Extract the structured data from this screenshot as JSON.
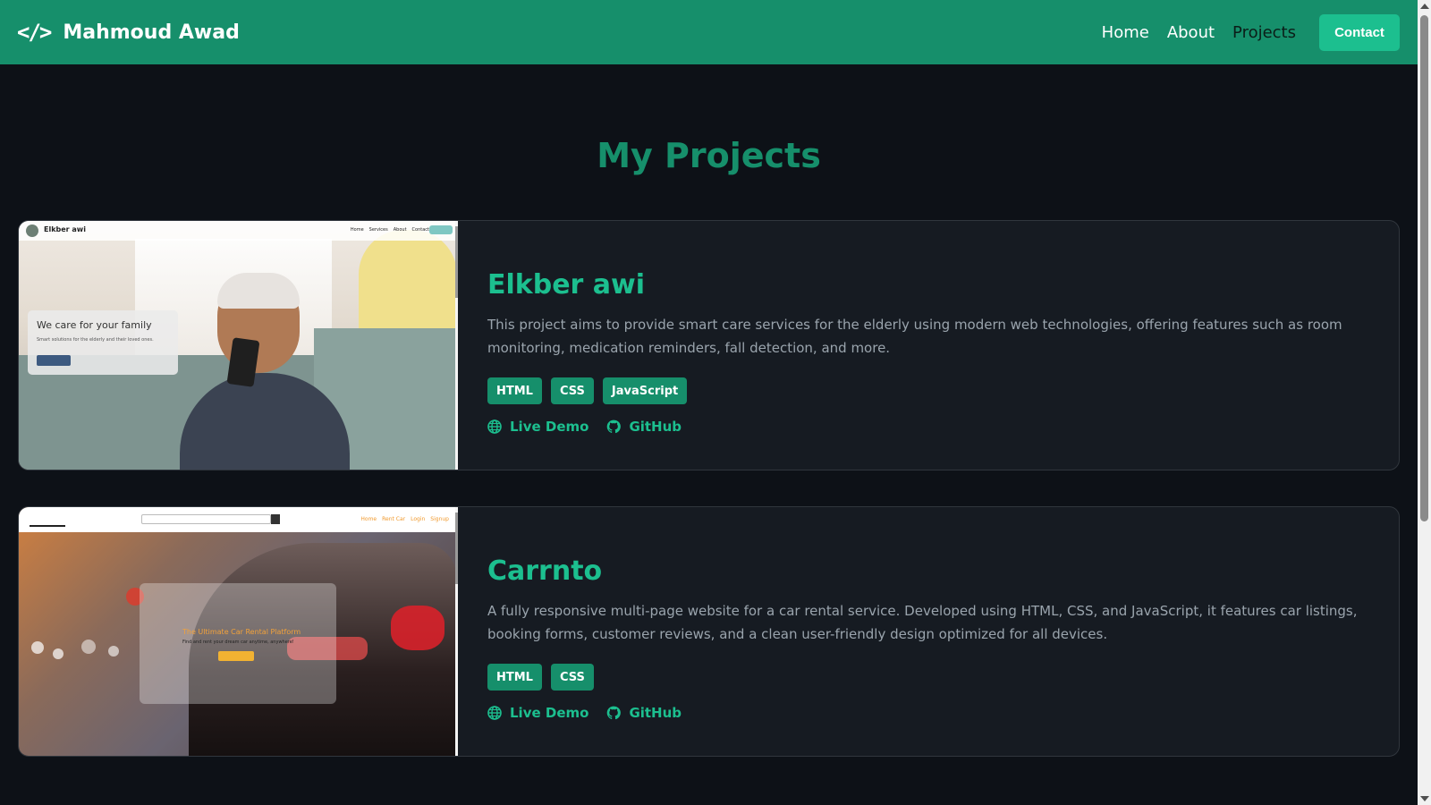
{
  "navbar": {
    "brand_icon": "</>",
    "brand_name": "Mahmoud Awad",
    "links": [
      {
        "label": "Home"
      },
      {
        "label": "About"
      },
      {
        "label": "Projects"
      }
    ],
    "contact_label": "Contact",
    "colors": {
      "background": "#168f6b",
      "active": "#0b1d18",
      "contact_bg": "#1cbf8f"
    }
  },
  "section": {
    "title": "My Projects"
  },
  "projects": [
    {
      "title": "Elkber awi",
      "description": "This project aims to provide smart care services for the elderly using modern web technologies, offering features such as room monitoring, medication reminders, fall detection, and more.",
      "tags": [
        "HTML",
        "CSS",
        "JavaScript"
      ],
      "live_demo_label": "Live Demo",
      "github_label": "GitHub",
      "screenshot": {
        "brand": "Elkber awi",
        "nav": [
          "Home",
          "Services",
          "About",
          "Contact"
        ],
        "hero_title": "We care for your family",
        "hero_sub": "Smart solutions for the elderly and their loved ones."
      }
    },
    {
      "title": "Carrnto",
      "description": "A fully responsive multi-page website for a car rental service. Developed using HTML, CSS, and JavaScript, it features car listings, booking forms, customer reviews, and a clean user-friendly design optimized for all devices.",
      "tags": [
        "HTML",
        "CSS"
      ],
      "live_demo_label": "Live Demo",
      "github_label": "GitHub",
      "screenshot": {
        "nav": [
          "Home",
          "Rent Car",
          "Login",
          "Signup"
        ],
        "hero_title": "The Ultimate Car Rental Platform",
        "hero_sub": "Find and rent your dream car anytime, anywhere!"
      }
    }
  ],
  "icons": {
    "brand": "code-icon",
    "live_demo": "globe-icon",
    "github": "github-icon"
  }
}
